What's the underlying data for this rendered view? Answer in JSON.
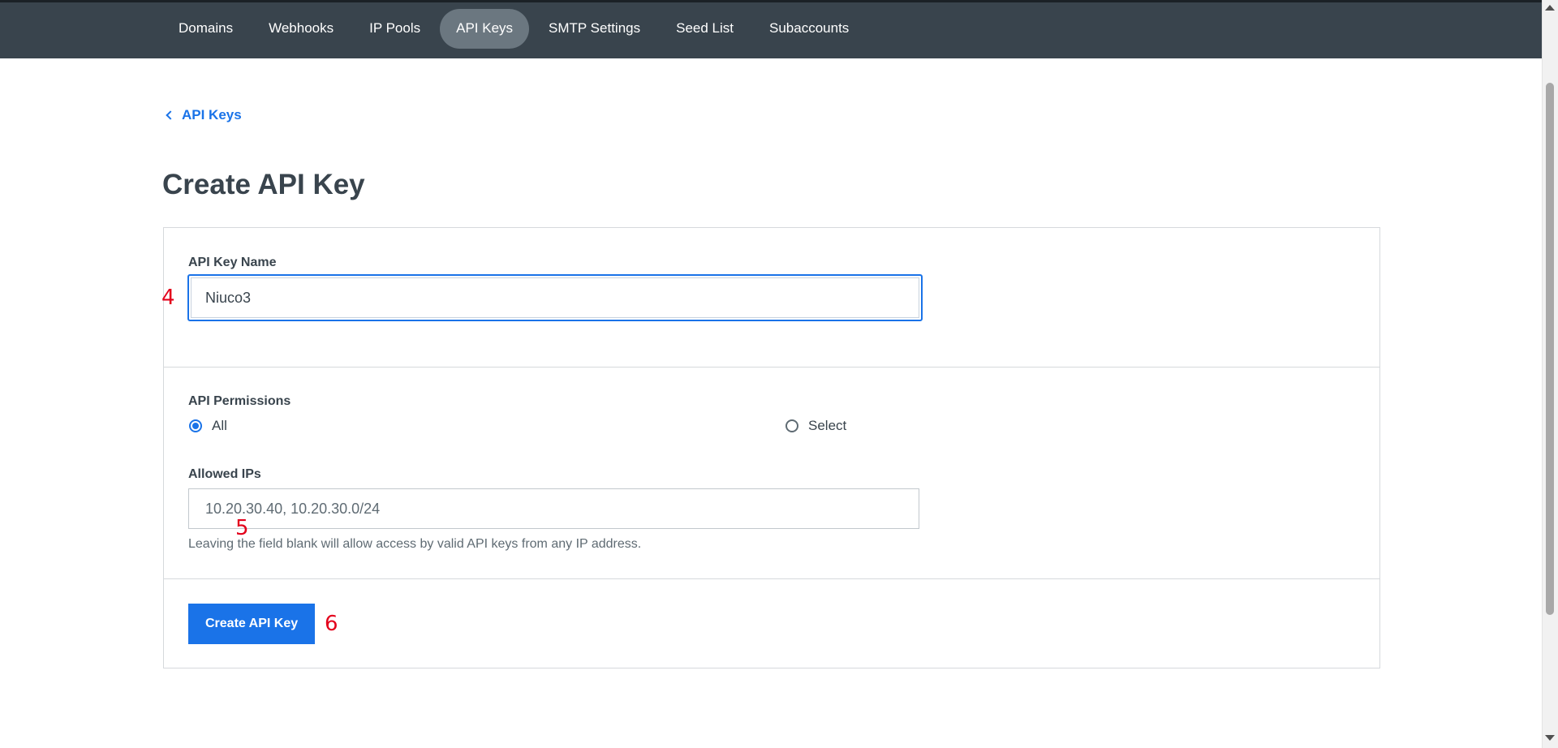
{
  "nav": {
    "items": [
      {
        "label": "Domains"
      },
      {
        "label": "Webhooks"
      },
      {
        "label": "IP Pools"
      },
      {
        "label": "API Keys",
        "active": true
      },
      {
        "label": "SMTP Settings"
      },
      {
        "label": "Seed List"
      },
      {
        "label": "Subaccounts"
      }
    ]
  },
  "breadcrumb": {
    "label": "API Keys"
  },
  "page": {
    "title": "Create API Key"
  },
  "form": {
    "name": {
      "label": "API Key Name",
      "value": "Niuco3"
    },
    "permissions": {
      "label": "API Permissions",
      "options": [
        {
          "label": "All",
          "checked": true
        },
        {
          "label": "Select",
          "checked": false
        }
      ]
    },
    "allowed_ips": {
      "label": "Allowed IPs",
      "placeholder": "10.20.30.40, 10.20.30.0/24",
      "value": "",
      "help": "Leaving the field blank will allow access by valid API keys from any IP address."
    },
    "submit": {
      "label": "Create API Key"
    }
  },
  "annotations": [
    "4",
    "5",
    "6"
  ],
  "colors": {
    "nav_bg": "#39444d",
    "accent": "#1a73e8",
    "annotation": "#e3001b"
  }
}
